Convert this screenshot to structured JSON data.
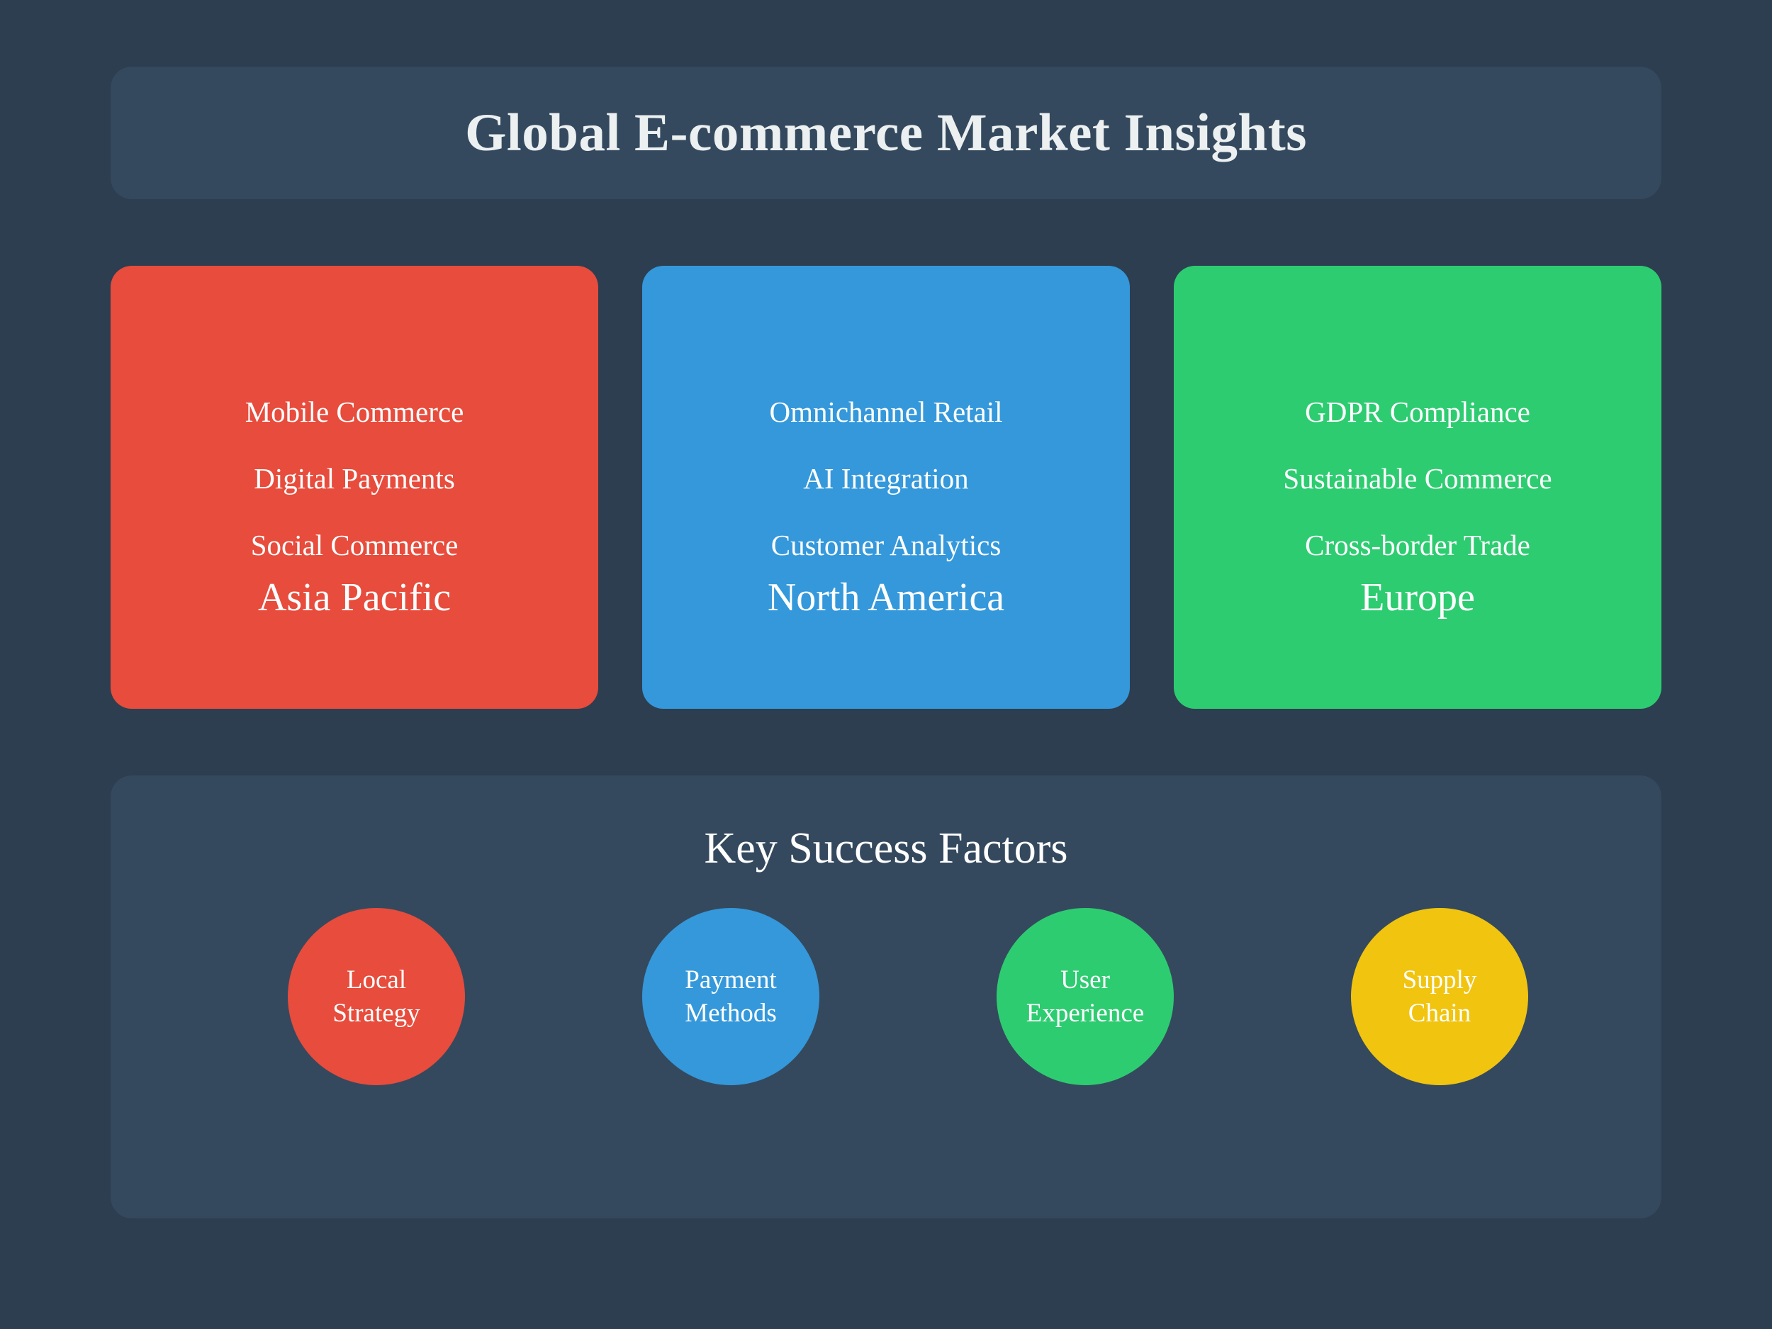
{
  "title": "Global E-commerce Market Insights",
  "colors": {
    "background": "#2c3e50",
    "panel": "#34495e",
    "red": "#e74c3c",
    "blue": "#3498db",
    "green": "#2ecc71",
    "yellow": "#f1c40f"
  },
  "regions": [
    {
      "name": "Asia Pacific",
      "color": "#e74c3c",
      "items": [
        "Mobile Commerce",
        "Digital Payments",
        "Social Commerce"
      ]
    },
    {
      "name": "North America",
      "color": "#3498db",
      "items": [
        "Omnichannel Retail",
        "AI Integration",
        "Customer Analytics"
      ]
    },
    {
      "name": "Europe",
      "color": "#2ecc71",
      "items": [
        "GDPR Compliance",
        "Sustainable Commerce",
        "Cross-border Trade"
      ]
    }
  ],
  "success_factors": {
    "title": "Key Success Factors",
    "factors": [
      {
        "label": "Local Strategy",
        "color": "#e74c3c"
      },
      {
        "label": "Payment Methods",
        "color": "#3498db"
      },
      {
        "label": "User Experience",
        "color": "#2ecc71"
      },
      {
        "label": "Supply Chain",
        "color": "#f1c40f"
      }
    ]
  }
}
